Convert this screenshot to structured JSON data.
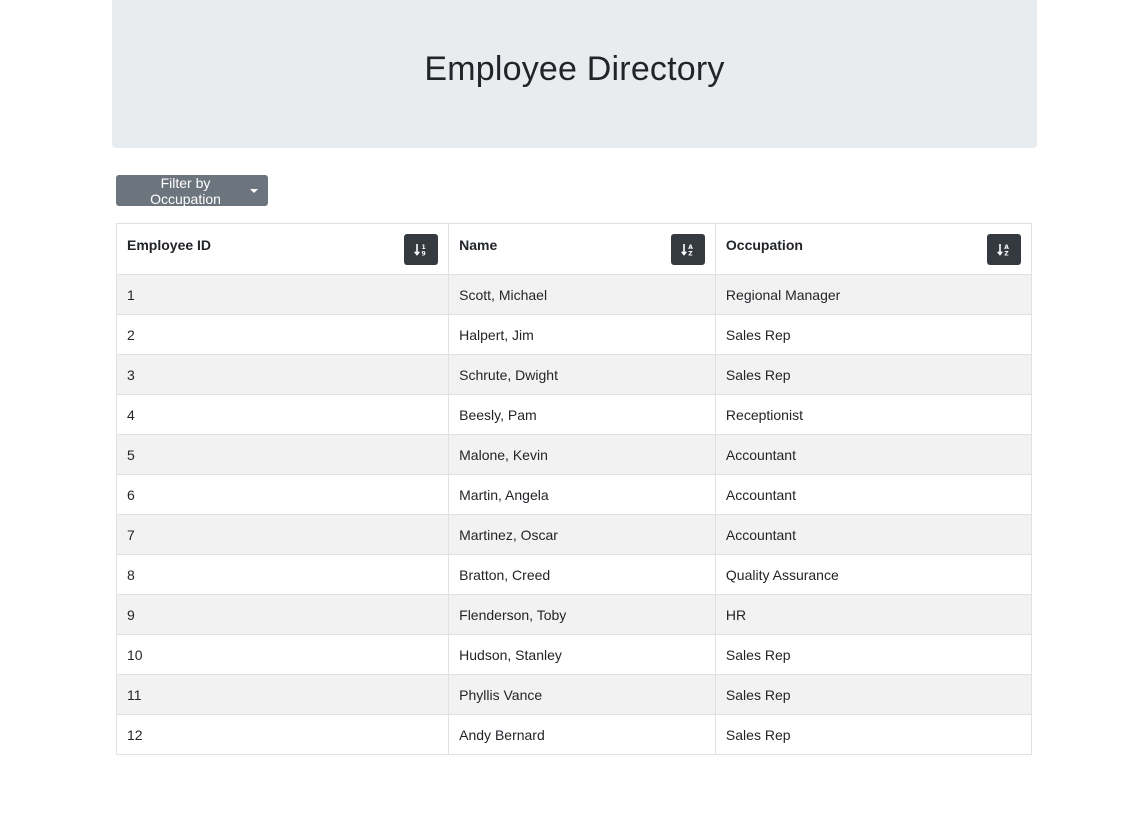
{
  "header": {
    "title": "Employee Directory"
  },
  "filter": {
    "label": "Filter by Occupation"
  },
  "table": {
    "columns": [
      {
        "label": "Employee ID",
        "sort_icon": "sort-numeric-icon"
      },
      {
        "label": "Name",
        "sort_icon": "sort-alpha-icon"
      },
      {
        "label": "Occupation",
        "sort_icon": "sort-alpha-icon"
      }
    ],
    "rows": [
      {
        "id": "1",
        "name": "Scott, Michael",
        "occupation": "Regional Manager"
      },
      {
        "id": "2",
        "name": "Halpert, Jim",
        "occupation": "Sales Rep"
      },
      {
        "id": "3",
        "name": "Schrute, Dwight",
        "occupation": "Sales Rep"
      },
      {
        "id": "4",
        "name": "Beesly, Pam",
        "occupation": "Receptionist"
      },
      {
        "id": "5",
        "name": "Malone, Kevin",
        "occupation": "Accountant"
      },
      {
        "id": "6",
        "name": "Martin, Angela",
        "occupation": "Accountant"
      },
      {
        "id": "7",
        "name": "Martinez, Oscar",
        "occupation": "Accountant"
      },
      {
        "id": "8",
        "name": "Bratton, Creed",
        "occupation": "Quality Assurance"
      },
      {
        "id": "9",
        "name": "Flenderson, Toby",
        "occupation": "HR"
      },
      {
        "id": "10",
        "name": "Hudson, Stanley",
        "occupation": "Sales Rep"
      },
      {
        "id": "11",
        "name": "Phyllis Vance",
        "occupation": "Sales Rep"
      },
      {
        "id": "12",
        "name": "Andy Bernard",
        "occupation": "Sales Rep"
      }
    ]
  },
  "colors": {
    "jumbotron_bg": "#e9ecef",
    "filter_button_bg": "#6c757d",
    "sort_button_bg": "#343a40",
    "striped_row_bg": "#f2f2f2"
  }
}
